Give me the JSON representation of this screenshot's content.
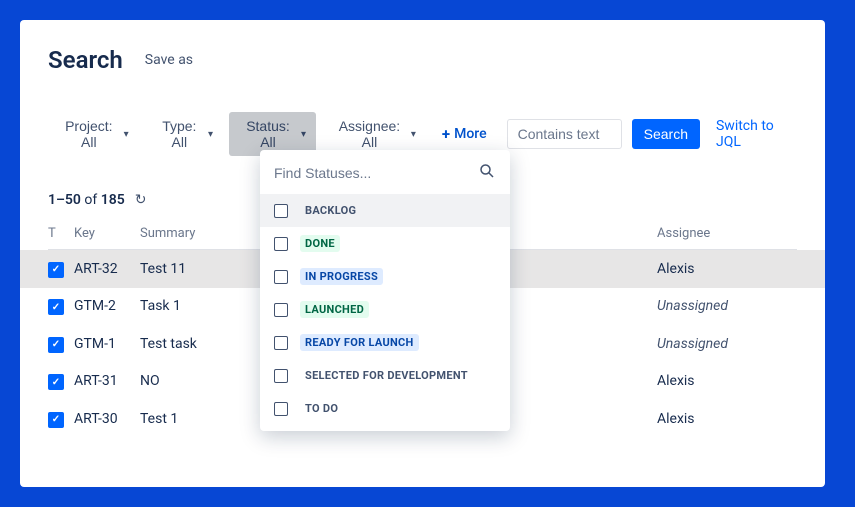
{
  "header": {
    "title": "Search",
    "save_as": "Save as"
  },
  "filters": {
    "project": "Project: All",
    "type": "Type: All",
    "status": "Status: All",
    "assignee": "Assignee: All",
    "more": "More",
    "contains_placeholder": "Contains text",
    "search_btn": "Search",
    "switch_link": "Switch to JQL"
  },
  "status_dropdown": {
    "find_placeholder": "Find Statuses...",
    "options": [
      {
        "label": "BACKLOG",
        "style": "loz-default",
        "hl": true
      },
      {
        "label": "DONE",
        "style": "loz-done"
      },
      {
        "label": "IN PROGRESS",
        "style": "loz-inprogress"
      },
      {
        "label": "LAUNCHED",
        "style": "loz-launched"
      },
      {
        "label": "READY FOR LAUNCH",
        "style": "loz-ready"
      },
      {
        "label": "SELECTED FOR DEVELOPMENT",
        "style": "loz-selected"
      },
      {
        "label": "TO DO",
        "style": "loz-todo"
      }
    ]
  },
  "count": {
    "range": "1–50",
    "of_text": "of",
    "total": "185"
  },
  "columns": {
    "t": "T",
    "key": "Key",
    "summary": "Summary",
    "assignee": "Assignee"
  },
  "rows": [
    {
      "key": "ART-32",
      "summary": "Test 11",
      "assignee": "Alexis",
      "unassigned": false,
      "selected": true
    },
    {
      "key": "GTM-2",
      "summary": "Task 1",
      "assignee": "Unassigned",
      "unassigned": true
    },
    {
      "key": "GTM-1",
      "summary": "Test task",
      "assignee": "Unassigned",
      "unassigned": true
    },
    {
      "key": "ART-31",
      "summary": "NO",
      "assignee": "Alexis",
      "unassigned": false
    },
    {
      "key": "ART-30",
      "summary": "Test 1",
      "assignee": "Alexis",
      "unassigned": false
    }
  ]
}
